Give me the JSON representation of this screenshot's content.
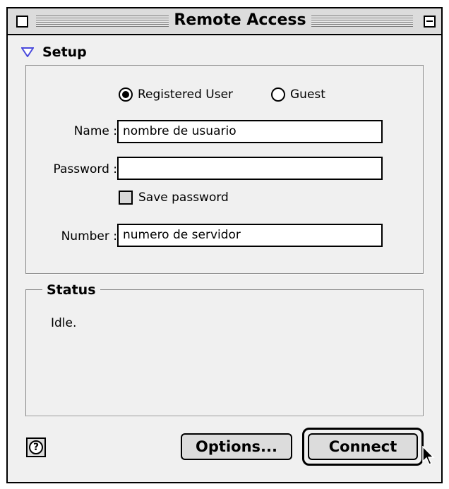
{
  "window": {
    "title": "Remote Access"
  },
  "setup": {
    "section_label": "Setup",
    "radio_options": [
      {
        "label": "Registered User",
        "selected": true
      },
      {
        "label": "Guest",
        "selected": false
      }
    ],
    "fields": {
      "name": {
        "label": "Name :",
        "value": "nombre de usuario"
      },
      "password": {
        "label": "Password :",
        "value": ""
      },
      "number": {
        "label": "Number :",
        "value": "numero de servidor"
      }
    },
    "save_password": {
      "label": "Save password",
      "checked": false
    }
  },
  "status": {
    "title": "Status",
    "text": "Idle."
  },
  "buttons": {
    "help": "?",
    "options": "Options...",
    "connect": "Connect"
  },
  "icons": {
    "disclosure": "disclosure-triangle-icon",
    "help": "help-icon",
    "cursor": "arrow-cursor-icon"
  },
  "colors": {
    "window_bg": "#f0f0f0",
    "disclosure_triangle": "#4a4adc"
  }
}
